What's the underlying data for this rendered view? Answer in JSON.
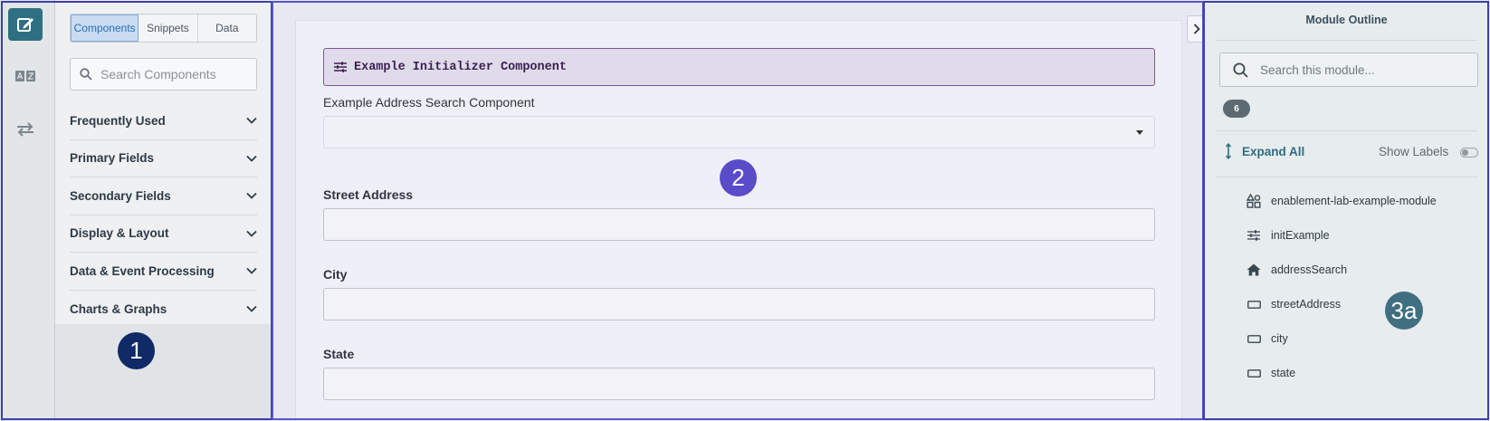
{
  "rail": {
    "items": [
      {
        "icon": "edit-icon",
        "active": true
      },
      {
        "icon": "translate-icon",
        "active": false
      },
      {
        "icon": "swap-arrows-icon",
        "active": false
      }
    ]
  },
  "left_panel": {
    "tabs": [
      {
        "label": "Components",
        "active": true
      },
      {
        "label": "Snippets",
        "active": false
      },
      {
        "label": "Data",
        "active": false
      }
    ],
    "search": {
      "placeholder": "Search Components",
      "value": ""
    },
    "categories": [
      {
        "label": "Frequently Used"
      },
      {
        "label": "Primary Fields"
      },
      {
        "label": "Secondary Fields"
      },
      {
        "label": "Display & Layout"
      },
      {
        "label": "Data & Event Processing"
      },
      {
        "label": "Charts & Graphs"
      }
    ]
  },
  "canvas": {
    "initializer": {
      "label": "Example Initializer Component"
    },
    "address_search": {
      "label": "Example Address Search Component",
      "value": ""
    },
    "fields": [
      {
        "label": "Street Address",
        "value": ""
      },
      {
        "label": "City",
        "value": ""
      },
      {
        "label": "State",
        "value": ""
      }
    ]
  },
  "outline": {
    "title": "Module Outline",
    "search": {
      "placeholder": "Search this module...",
      "value": ""
    },
    "count": "6",
    "expand_all_label": "Expand All",
    "show_labels_label": "Show Labels",
    "show_labels_on": false,
    "items": [
      {
        "label": "enablement-lab-example-module",
        "icon": "module-shapes-icon"
      },
      {
        "label": "initExample",
        "icon": "sliders-icon"
      },
      {
        "label": "addressSearch",
        "icon": "home-icon"
      },
      {
        "label": "streetAddress",
        "icon": "textbox-icon"
      },
      {
        "label": "city",
        "icon": "textbox-icon"
      },
      {
        "label": "state",
        "icon": "textbox-icon"
      }
    ]
  },
  "callouts": [
    {
      "label": "1",
      "color": "#0f2a66"
    },
    {
      "label": "2",
      "color": "#5a4bc8"
    },
    {
      "label": "3a",
      "color": "#3f6f80"
    }
  ],
  "colors": {
    "rail_active": "#2f6f82",
    "tab_active_bg": "#c9dcf2",
    "section_border": "#3d40a8",
    "accent_teal": "#2e6d82"
  }
}
